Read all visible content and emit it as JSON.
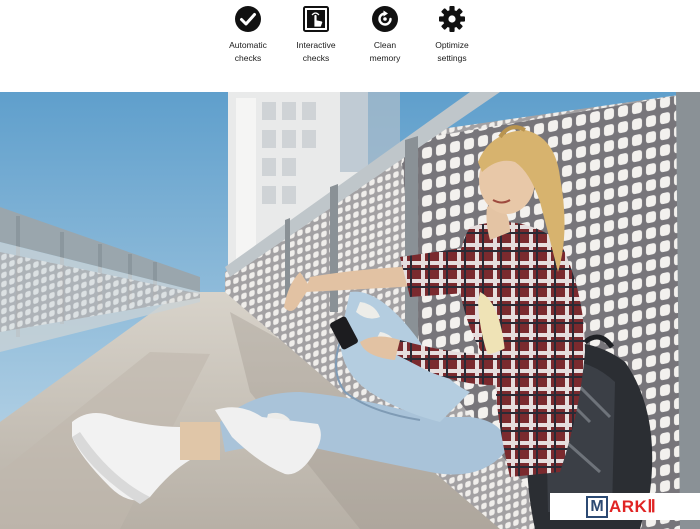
{
  "features": [
    {
      "icon": "checkmark-circle-icon",
      "label": "Automatic\nchecks"
    },
    {
      "icon": "touch-screen-icon",
      "label": "Interactive\nchecks"
    },
    {
      "icon": "refresh-circle-icon",
      "label": "Clean\nmemory"
    },
    {
      "icon": "gear-icon",
      "label": "Optimize\nsettings"
    }
  ],
  "photo": {
    "subject": "woman-sitting-on-bridge-with-phone"
  },
  "watermark": {
    "boxed_letter": "M",
    "rest": "ARKⅡ"
  },
  "colors": {
    "icon": "#111111",
    "brand_blue": "#2c4a73",
    "brand_red": "#e02424"
  }
}
